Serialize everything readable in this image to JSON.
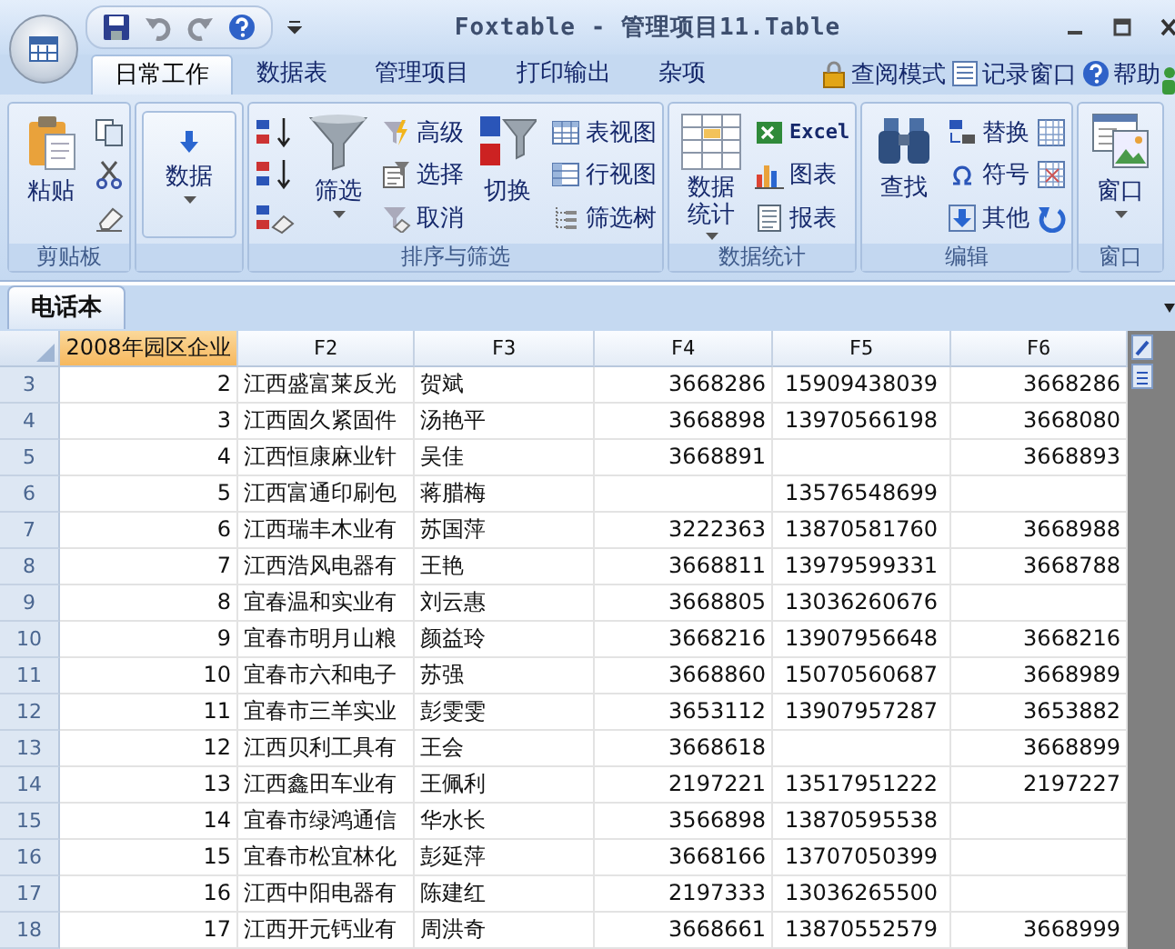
{
  "window": {
    "title": "Foxtable - 管理项目11.Table"
  },
  "tabs": [
    {
      "label": "日常工作",
      "selected": true
    },
    {
      "label": "数据表",
      "selected": false
    },
    {
      "label": "管理项目",
      "selected": false
    },
    {
      "label": "打印输出",
      "selected": false
    },
    {
      "label": "杂项",
      "selected": false
    }
  ],
  "tab_links": [
    {
      "label": "查阅模式"
    },
    {
      "label": "记录窗口"
    },
    {
      "label": "帮助"
    }
  ],
  "ribbon_groups": [
    {
      "label": "剪贴板",
      "items": [
        {
          "kind": "large",
          "label": "粘贴"
        },
        {
          "kind": "icon"
        },
        {
          "kind": "icon"
        },
        {
          "kind": "icon"
        }
      ]
    },
    {
      "items": [
        {
          "kind": "large",
          "label": "数据",
          "dropdown": true
        }
      ]
    },
    {
      "label": "排序与筛选",
      "items": [
        {
          "kind": "icon"
        },
        {
          "kind": "icon"
        },
        {
          "kind": "icon"
        },
        {
          "kind": "large",
          "label": "筛选",
          "dropdown": true
        },
        {
          "kind": "small",
          "label": "高级"
        },
        {
          "kind": "small",
          "label": "选择"
        },
        {
          "kind": "small",
          "label": "取消"
        },
        {
          "kind": "large",
          "label": "切换"
        },
        {
          "kind": "small",
          "label": "表视图"
        },
        {
          "kind": "small",
          "label": "行视图"
        },
        {
          "kind": "small",
          "label": "筛选树"
        }
      ]
    },
    {
      "label": "数据统计",
      "items": [
        {
          "kind": "large",
          "label": "数据统计",
          "dropdown": true
        },
        {
          "kind": "small",
          "label": "Excel"
        },
        {
          "kind": "small",
          "label": "图表"
        },
        {
          "kind": "small",
          "label": "报表"
        }
      ]
    },
    {
      "label": "编辑",
      "items": [
        {
          "kind": "large",
          "label": "查找"
        },
        {
          "kind": "small",
          "label": "替换"
        },
        {
          "kind": "small",
          "label": "符号"
        },
        {
          "kind": "small",
          "label": "其他"
        },
        {
          "kind": "icon"
        },
        {
          "kind": "icon"
        },
        {
          "kind": "icon"
        }
      ]
    },
    {
      "label": "窗口",
      "items": [
        {
          "kind": "large",
          "label": "窗口",
          "dropdown": true
        }
      ]
    }
  ],
  "doc_tabs": [
    {
      "label": "电话本",
      "selected": true
    }
  ],
  "table": {
    "columns": [
      {
        "label": "2008年园区企业",
        "selected": true
      },
      {
        "label": "F2",
        "selected": false
      },
      {
        "label": "F3",
        "selected": false
      },
      {
        "label": "F4",
        "selected": false
      },
      {
        "label": "F5",
        "selected": false
      },
      {
        "label": "F6",
        "selected": false
      }
    ],
    "rows": [
      {
        "number": "3",
        "cells": [
          "2",
          "江西盛富莱反光",
          "贺斌",
          "3668286",
          "15909438039",
          "3668286"
        ]
      },
      {
        "number": "4",
        "cells": [
          "3",
          "江西固久紧固件",
          "汤艳平",
          "3668898",
          "13970566198",
          "3668080"
        ]
      },
      {
        "number": "5",
        "cells": [
          "4",
          "江西恒康麻业针",
          "吴佳",
          "3668891",
          "",
          "3668893"
        ]
      },
      {
        "number": "6",
        "cells": [
          "5",
          "江西富通印刷包",
          "蒋腊梅",
          "",
          "13576548699",
          ""
        ]
      },
      {
        "number": "7",
        "cells": [
          "6",
          "江西瑞丰木业有",
          "苏国萍",
          "3222363",
          "13870581760",
          "3668988"
        ]
      },
      {
        "number": "8",
        "cells": [
          "7",
          "江西浩风电器有",
          "王艳",
          "3668811",
          "13979599331",
          "3668788"
        ]
      },
      {
        "number": "9",
        "cells": [
          "8",
          "宜春温和实业有",
          "刘云惠",
          "3668805",
          "13036260676",
          ""
        ]
      },
      {
        "number": "10",
        "cells": [
          "9",
          "宜春市明月山粮",
          "颜益玲",
          "3668216",
          "13907956648",
          "3668216"
        ]
      },
      {
        "number": "11",
        "cells": [
          "10",
          "宜春市六和电子",
          "苏强",
          "3668860",
          "15070560687",
          "3668989"
        ]
      },
      {
        "number": "12",
        "cells": [
          "11",
          "宜春市三羊实业",
          "彭雯雯",
          "3653112",
          "13907957287",
          "3653882"
        ]
      },
      {
        "number": "13",
        "cells": [
          "12",
          "江西贝利工具有",
          "王会",
          "3668618",
          "",
          "3668899"
        ]
      },
      {
        "number": "14",
        "cells": [
          "13",
          "江西鑫田车业有",
          "王佩利",
          "2197221",
          "13517951222",
          "2197227"
        ]
      },
      {
        "number": "15",
        "cells": [
          "14",
          "宜春市绿鸿通信",
          "华水长",
          "3566898",
          "13870595538",
          ""
        ]
      },
      {
        "number": "16",
        "cells": [
          "15",
          "宜春市松宜林化",
          "彭延萍",
          "3668166",
          "13707050399",
          ""
        ]
      },
      {
        "number": "17",
        "cells": [
          "16",
          "江西中阳电器有",
          "陈建红",
          "2197333",
          "13036265500",
          ""
        ]
      },
      {
        "number": "18",
        "cells": [
          "17",
          "江西开元钙业有",
          "周洪奇",
          "3668661",
          "13870552579",
          "3668999"
        ]
      }
    ]
  }
}
